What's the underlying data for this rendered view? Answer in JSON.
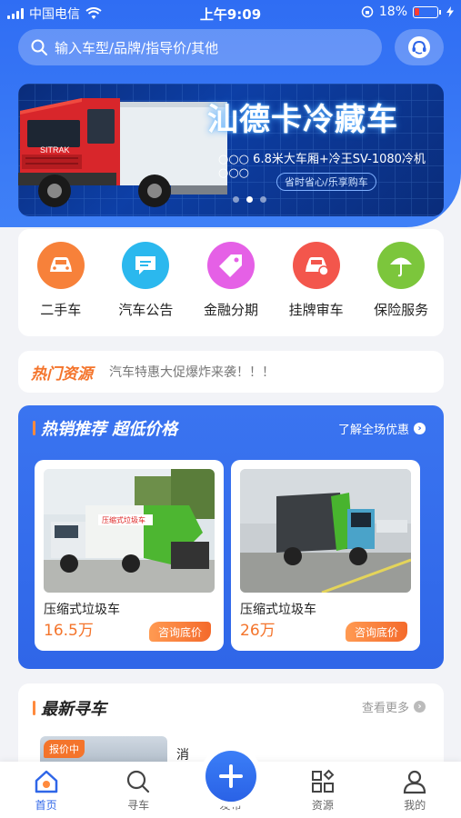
{
  "status_bar": {
    "carrier": "中国电信",
    "time": "上午9:09",
    "battery": "18%"
  },
  "search": {
    "placeholder": "输入车型/品牌/指导价/其他"
  },
  "banner": {
    "title": "汕德卡冷藏车",
    "subtitle": "6.8米大车厢+冷王SV-1080冷机",
    "slogan": "省时省心/乐享购车",
    "truck_brand": "SITRAK"
  },
  "quick_menu": [
    {
      "label": "二手车",
      "icon": "car-icon",
      "color": "#f7813a"
    },
    {
      "label": "汽车公告",
      "icon": "message-icon",
      "color": "#2bb8ee"
    },
    {
      "label": "金融分期",
      "icon": "tag-icon",
      "color": "#e560e6"
    },
    {
      "label": "挂牌审车",
      "icon": "car-plate-icon",
      "color": "#f3564c"
    },
    {
      "label": "保险服务",
      "icon": "umbrella-icon",
      "color": "#7cc63c"
    }
  ],
  "hot": {
    "tag": "热门资源",
    "text": "汽车特惠大促爆炸来袭！！！"
  },
  "recommend": {
    "title": "热销推荐  超低价格",
    "more": "了解全场优惠",
    "cards": [
      {
        "name": "压缩式垃圾车",
        "price": "16.5万",
        "button": "咨询底价"
      },
      {
        "name": "压缩式垃圾车",
        "price": "26万",
        "button": "咨询底价"
      }
    ]
  },
  "latest": {
    "title": "最新寻车",
    "more": "查看更多",
    "badge": "报价中",
    "text": "消"
  },
  "tabbar": [
    {
      "label": "首页",
      "icon": "home-icon"
    },
    {
      "label": "寻车",
      "icon": "search-icon"
    },
    {
      "label": "发布",
      "icon": "plus-icon"
    },
    {
      "label": "资源",
      "icon": "grid-icon"
    },
    {
      "label": "我的",
      "icon": "user-icon"
    }
  ],
  "colors": {
    "primary": "#2f66e8",
    "accent": "#f4742b"
  }
}
